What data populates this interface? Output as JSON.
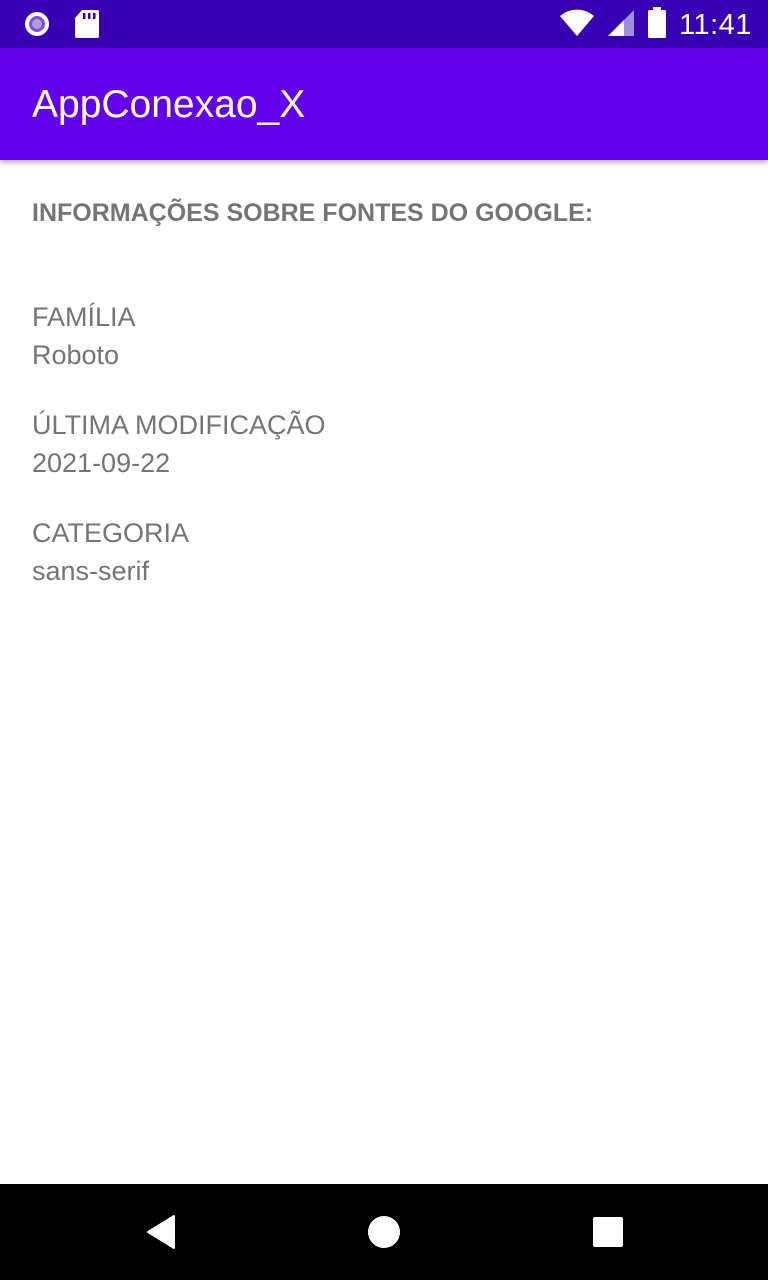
{
  "status_bar": {
    "time": "11:41",
    "left_icons": [
      "circle-notification-icon",
      "sd-card-icon"
    ],
    "right_icons": [
      "wifi-icon",
      "cell-signal-icon",
      "battery-icon"
    ],
    "background_color": "#3700b3"
  },
  "app_bar": {
    "title": "AppConexao_X",
    "background_color": "#6200ee"
  },
  "content": {
    "heading": "INFORMAÇÕES SOBRE FONTES DO GOOGLE:",
    "fields": [
      {
        "label": "FAMÍLIA",
        "value": "Roboto"
      },
      {
        "label": "ÚLTIMA MODIFICAÇÃO",
        "value": "2021-09-22"
      },
      {
        "label": "CATEGORIA",
        "value": "sans-serif"
      }
    ],
    "text_color": "#757575"
  },
  "nav_bar": {
    "buttons": [
      "back-icon",
      "home-icon",
      "recents-icon"
    ]
  }
}
